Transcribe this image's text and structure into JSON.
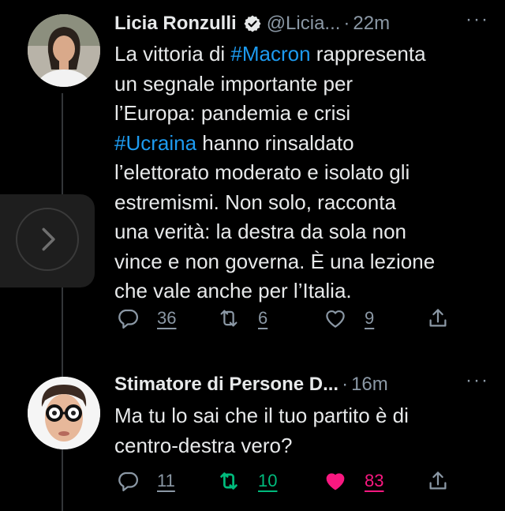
{
  "tweets": [
    {
      "name": "Licia Ronzulli",
      "handle": "@Licia...",
      "separator": "·",
      "time": "22m",
      "more": "···",
      "text_parts": {
        "p1": "La vittoria di ",
        "h1": "#Macron",
        "p2": " rappresenta\nun segnale importante per\nl’Europa: pandemia e crisi\n",
        "h2": "#Ucraina",
        "p3": " hanno rinsaldato\nl’elettorato moderato e isolato gli\nestremismi. Non solo, racconta\nuna verità: la destra da sola non\nvince e non governa. È una lezione\nche vale anche per l’Italia."
      },
      "replies": "36",
      "retweets": "6",
      "likes": "9"
    },
    {
      "name": "Stimatore di Persone D...",
      "separator": "·",
      "time": "16m",
      "more": "···",
      "text": "Ma tu lo sai che il tuo partito è di\ncentro-destra vero?",
      "replies": "11",
      "retweets": "10",
      "likes": "83"
    }
  ],
  "icons": {
    "verified": "verified-badge-icon",
    "reply": "reply-icon",
    "retweet": "retweet-icon",
    "like": "heart-icon",
    "share": "share-icon",
    "nav": "chevron-right-icon"
  },
  "colors": {
    "hashtag": "#1d9bf0",
    "retweet_active": "#00ba7c",
    "like_active": "#f91880",
    "secondary_text": "#8b98a5"
  }
}
